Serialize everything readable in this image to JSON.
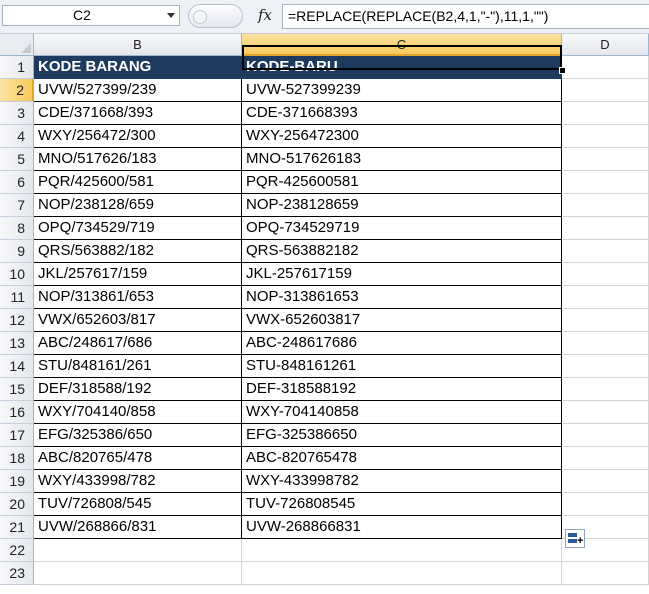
{
  "formula_bar": {
    "name_box": "C2",
    "fx_label": "fx",
    "formula": "=REPLACE(REPLACE(B2,4,1,\"-\"),11,1,\"\")"
  },
  "columns": [
    "B",
    "C",
    "D"
  ],
  "active_cell": "C2",
  "rows": [
    {
      "num": "1",
      "b": "KODE BARANG",
      "c": "KODE-BARU"
    },
    {
      "num": "2",
      "b": "UVW/527399/239",
      "c": "UVW-527399239"
    },
    {
      "num": "3",
      "b": "CDE/371668/393",
      "c": "CDE-371668393"
    },
    {
      "num": "4",
      "b": "WXY/256472/300",
      "c": "WXY-256472300"
    },
    {
      "num": "5",
      "b": "MNO/517626/183",
      "c": "MNO-517626183"
    },
    {
      "num": "6",
      "b": "PQR/425600/581",
      "c": "PQR-425600581"
    },
    {
      "num": "7",
      "b": "NOP/238128/659",
      "c": "NOP-238128659"
    },
    {
      "num": "8",
      "b": "OPQ/734529/719",
      "c": "OPQ-734529719"
    },
    {
      "num": "9",
      "b": "QRS/563882/182",
      "c": "QRS-563882182"
    },
    {
      "num": "10",
      "b": "JKL/257617/159",
      "c": "JKL-257617159"
    },
    {
      "num": "11",
      "b": "NOP/313861/653",
      "c": "NOP-313861653"
    },
    {
      "num": "12",
      "b": "VWX/652603/817",
      "c": "VWX-652603817"
    },
    {
      "num": "13",
      "b": "ABC/248617/686",
      "c": "ABC-248617686"
    },
    {
      "num": "14",
      "b": "STU/848161/261",
      "c": "STU-848161261"
    },
    {
      "num": "15",
      "b": "DEF/318588/192",
      "c": "DEF-318588192"
    },
    {
      "num": "16",
      "b": "WXY/704140/858",
      "c": "WXY-704140858"
    },
    {
      "num": "17",
      "b": "EFG/325386/650",
      "c": "EFG-325386650"
    },
    {
      "num": "18",
      "b": "ABC/820765/478",
      "c": "ABC-820765478"
    },
    {
      "num": "19",
      "b": "WXY/433998/782",
      "c": "WXY-433998782"
    },
    {
      "num": "20",
      "b": "TUV/726808/545",
      "c": "TUV-726808545"
    },
    {
      "num": "21",
      "b": "UVW/268866/831",
      "c": "UVW-268866831"
    },
    {
      "num": "22",
      "b": "",
      "c": ""
    },
    {
      "num": "23",
      "b": "",
      "c": ""
    }
  ],
  "colors": {
    "header_fill": "#1f3a5f",
    "header_text": "#ffffff",
    "active_header": "#f7c95c"
  }
}
